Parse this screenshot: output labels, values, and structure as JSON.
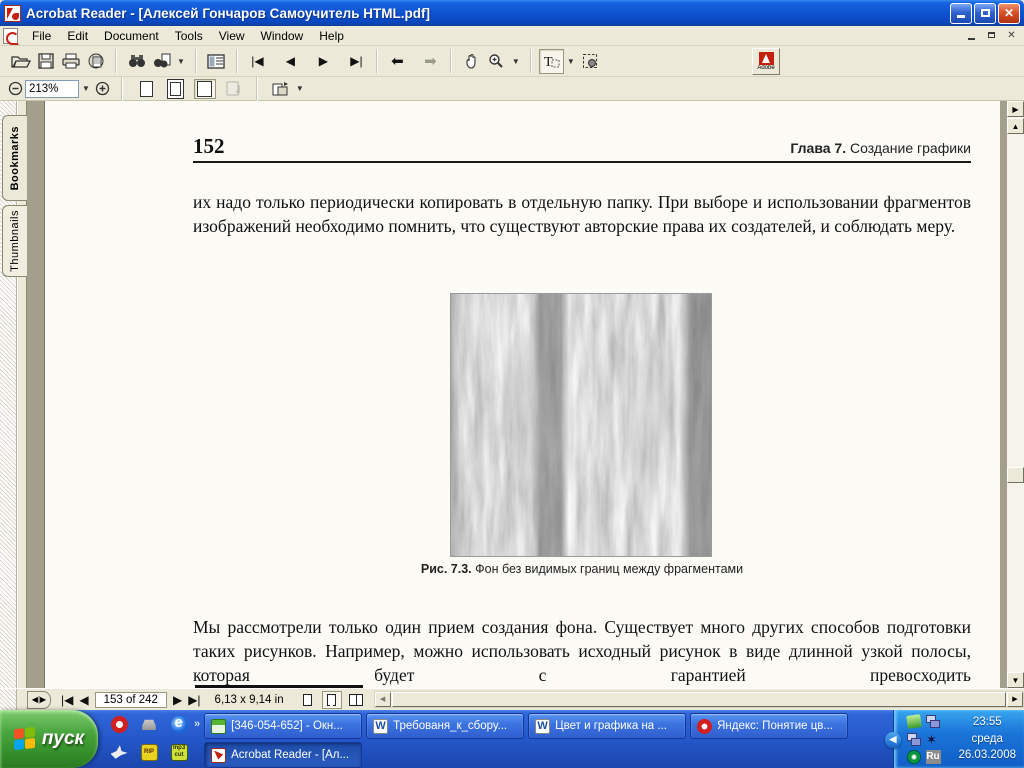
{
  "window": {
    "title": "Acrobat Reader - [Алексей Гончаров Самоучитель HTML.pdf]"
  },
  "menu": {
    "items": [
      "File",
      "Edit",
      "Document",
      "Tools",
      "View",
      "Window",
      "Help"
    ]
  },
  "toolbar": {
    "zoom_value": "213%",
    "adobe_label": "Adobe"
  },
  "sidebar": {
    "tabs": [
      "Bookmarks",
      "Thumbnails"
    ]
  },
  "document": {
    "page_number": "152",
    "chapter_bold": "Глава 7.",
    "chapter_rest": " Создание графики",
    "para1": "их надо только периодически копировать в отдельную папку. При выборе и использовании фрагментов изображений необходимо помнить, что существуют авторские права их создателей, и соблюдать меру.",
    "caption_bold": "Рис. 7.3.",
    "caption_rest": " Фон без видимых границ между фрагментами",
    "para2": "Мы рассмотрели только один прием создания фона. Существует много других способов подготовки таких рисунков. Например, можно использовать исходный рисунок в виде длинной узкой полосы, которая будет с гарантией превосходить"
  },
  "statusbar": {
    "page_indicator": "153 of 242",
    "page_size": "6,13 x 9,14 in"
  },
  "taskbar": {
    "start_label": "пуск",
    "tasks": [
      {
        "label": "[346-054-652] - Окн..."
      },
      {
        "label": "Требованя_к_сбору..."
      },
      {
        "label": "Цвет и графика на ..."
      },
      {
        "label": "Яндекс: Понятие цв..."
      },
      {
        "label": "Acrobat Reader - [Ал..."
      }
    ],
    "tray": {
      "time": "23:55",
      "day": "среда",
      "date": "26.03.2008",
      "language": "Ru"
    }
  },
  "icons": {
    "quick_launch": [
      "opera-icon",
      "car-icon",
      "ie-icon",
      "chevron-icon",
      "dove-icon",
      "rip-icon",
      "mp3cut-icon"
    ],
    "tray": [
      "download-manager-icon",
      "network-icon",
      "network2-icon",
      "star-icon",
      "eye-icon",
      "language-indicator"
    ]
  },
  "colors": {
    "titlebar_blue": "#0f55d2",
    "ui_beige": "#ece9d8",
    "taskbar_blue": "#2458cb",
    "start_green": "#48a43c",
    "close_red": "#da4f26"
  }
}
